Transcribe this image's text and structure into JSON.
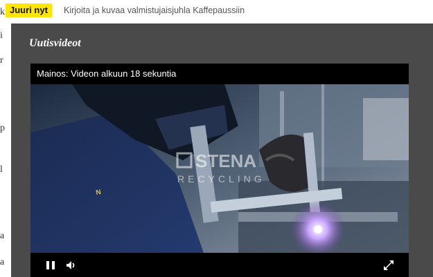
{
  "ticker": {
    "badge": "Juuri nyt",
    "headline": "Kirjoita ja kuvaa valmistujaisjuhla Kaffepaussiin"
  },
  "background_fragments": [
    "k",
    "i",
    "r",
    "p",
    "l",
    "a",
    "a"
  ],
  "panel": {
    "title": "Uutisvideot"
  },
  "player": {
    "ad_label": "Mainos: Videon alkuun 18 sekuntia",
    "watermark": {
      "brand": "STENA",
      "sub": "RECYCLING"
    },
    "controls": {
      "pause_icon": "pause-icon",
      "volume_icon": "volume-icon",
      "fullscreen_icon": "fullscreen-icon"
    }
  },
  "colors": {
    "badge": "#ffe600",
    "panel": "#4a4a4a",
    "player_bar": "#000000"
  }
}
